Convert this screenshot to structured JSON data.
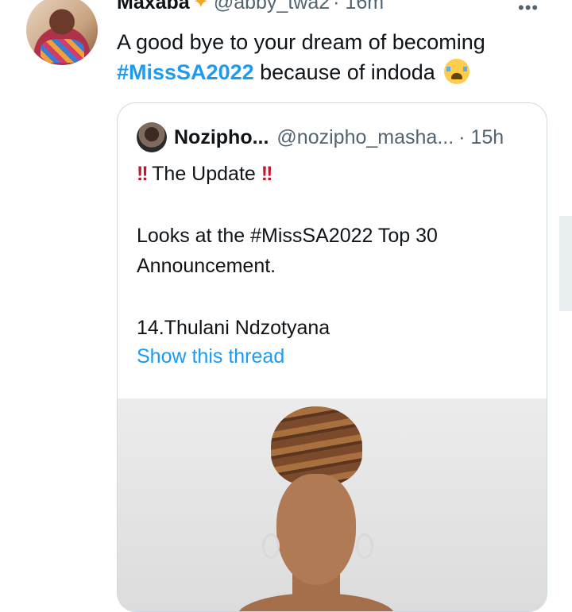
{
  "tweet": {
    "author_name": "Maxaba",
    "author_emoji": "sparkles",
    "handle": "@abby_twa2",
    "time": "· 16m",
    "more_label": "•••",
    "text_line1": "A good bye to your dream of becoming",
    "hashtag": "#MissSA2022",
    "text_after_hashtag": " because of indoda",
    "text_emoji": "loudly-crying-face"
  },
  "quoted": {
    "author_name": "Nozipho...",
    "handle": "@nozipho_masha...",
    "time": "· 15h",
    "bang_left": "!!",
    "title": " The Update ",
    "bang_right": "!!",
    "line2": "Looks at the #MissSA2022 Top 30",
    "line3": "Announcement.",
    "line4": "14.Thulani Ndzotyana",
    "show_thread": "Show this thread",
    "media": "photo"
  },
  "colors": {
    "link": "#1d9bf0",
    "secondary_text": "#536471",
    "border": "#cfd9de"
  }
}
